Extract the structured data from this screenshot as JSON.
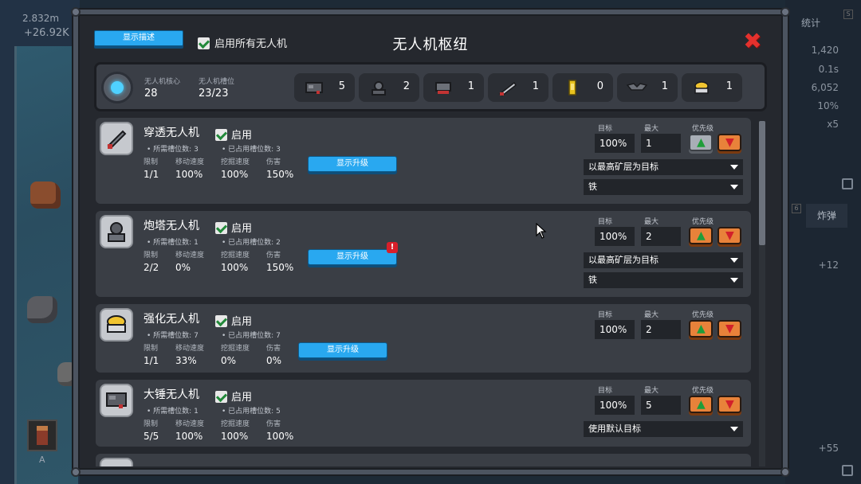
{
  "background": {
    "top_stat": "2.832m",
    "top_stat2": "+26.92K",
    "slot_label": "A",
    "right_tab": "统计",
    "right_tab_badge": "S",
    "right_values": [
      "1,420",
      "0.1s",
      "6,052",
      "10%",
      "x5"
    ],
    "bomb_tab": "炸弹",
    "bomb_badge": "6",
    "right_plus1": "+12",
    "right_plus2": "+55"
  },
  "header": {
    "show_desc_label": "显示描述",
    "enable_all_label": "启用所有无人机",
    "title": "无人机枢纽",
    "close_icon": "close-icon"
  },
  "summary": {
    "core_label": "无人机核心",
    "core_value": "28",
    "slots_label": "无人机槽位",
    "slots_value": "23/23",
    "drones": [
      {
        "icon": "hammer-drone-icon",
        "count": "5"
      },
      {
        "icon": "turret-drone-icon",
        "count": "2"
      },
      {
        "icon": "red-drone-icon",
        "count": "1"
      },
      {
        "icon": "pierce-drone-icon",
        "count": "1"
      },
      {
        "icon": "yellow-canister-icon",
        "count": "0"
      },
      {
        "icon": "bat-drone-icon",
        "count": "1"
      },
      {
        "icon": "booster-drone-icon",
        "count": "1"
      }
    ]
  },
  "labels": {
    "enable": "启用",
    "limit": "限制",
    "move_speed": "移动速度",
    "mine_speed": "挖掘速度",
    "damage": "伤害",
    "show_upgrade": "显示升级",
    "target": "目标",
    "max": "最大",
    "priority": "优先级"
  },
  "drones": [
    {
      "name": "穿透无人机",
      "slot_req": "• 所需槽位数: 3",
      "slot_used": "• 已占用槽位数: 3",
      "limit": "1/1",
      "move": "100%",
      "mine": "100%",
      "damage": "150%",
      "target": "100%",
      "max": "1",
      "target_mode": "以最高矿层为目标",
      "ore": "铁",
      "upgrade_alert": false,
      "up_disabled": true
    },
    {
      "name": "炮塔无人机",
      "slot_req": "• 所需槽位数: 1",
      "slot_used": "• 已占用槽位数: 2",
      "limit": "2/2",
      "move": "0%",
      "mine": "100%",
      "damage": "150%",
      "target": "100%",
      "max": "2",
      "target_mode": "以最高矿层为目标",
      "ore": "铁",
      "upgrade_alert": true,
      "up_disabled": false
    },
    {
      "name": "强化无人机",
      "slot_req": "• 所需槽位数: 7",
      "slot_used": "• 已占用槽位数: 7",
      "limit": "1/1",
      "move": "33%",
      "mine": "0%",
      "damage": "0%",
      "target": "100%",
      "max": "2",
      "upgrade_alert": false,
      "up_disabled": false
    },
    {
      "name": "大锤无人机",
      "slot_req": "• 所需槽位数: 1",
      "slot_used": "• 已占用槽位数: 5",
      "limit": "5/5",
      "move": "100%",
      "mine": "100%",
      "damage": "100%",
      "target": "100%",
      "max": "5",
      "target_mode": "使用默认目标",
      "upgrade_alert": false,
      "up_disabled": false
    }
  ],
  "alert_badge": "!",
  "colors": {
    "accent_blue": "#29a8f0",
    "priority_orange": "#e8823a",
    "close_red": "#e4312d"
  }
}
